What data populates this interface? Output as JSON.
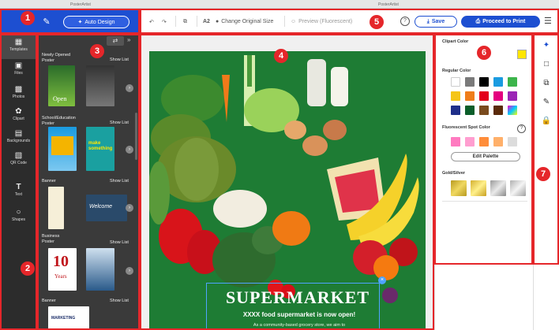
{
  "window": {
    "tab1_title": "PosterArtist",
    "tab2_title": "PosterArtist"
  },
  "header": {
    "auto_design_label": "Auto Design",
    "colors": {
      "brand": "#1d4fd1",
      "annotation": "#e5262a"
    }
  },
  "toolbar": {
    "size_label": "A2",
    "change_size_label": "Change Original Size",
    "preview_label": "Preview (Fluorescent)",
    "save_label": "Save",
    "print_label": "Proceed to Print",
    "help_label": "?"
  },
  "sidebar": {
    "items": [
      {
        "label": "Templates",
        "icon": "templates-icon"
      },
      {
        "label": "Files",
        "icon": "files-icon"
      },
      {
        "label": "Photos",
        "icon": "photos-icon"
      },
      {
        "label": "Clipart",
        "icon": "clipart-icon"
      },
      {
        "label": "Backgrounds",
        "icon": "backgrounds-icon"
      },
      {
        "label": "QR Code",
        "icon": "qrcode-icon"
      },
      {
        "label": "Text",
        "icon": "text-icon"
      },
      {
        "label": "Shapes",
        "icon": "shapes-icon"
      }
    ]
  },
  "templates": {
    "sections": [
      {
        "title": "Newly Opened\nPoster",
        "show_list": "Show List"
      },
      {
        "title": "School/Education\nPoster",
        "show_list": "Show List"
      },
      {
        "title": "Banner",
        "show_list": "Show List"
      },
      {
        "title": "Business\nPoster",
        "show_list": "Show List"
      },
      {
        "title": "Banner",
        "show_list": "Show List"
      }
    ],
    "thumb_texts": {
      "open": "Open",
      "make": "make something",
      "ten": "10",
      "years": "Years",
      "welcome": "Welcome",
      "marketing": "MARKETING"
    }
  },
  "poster": {
    "title": "SUPERMARKET",
    "subtitle": "XXXX food supermarket is now open!",
    "description": "As a community-based grocery store, we aim to"
  },
  "color_panel": {
    "clipart_color": "Clipart Color",
    "regular_color": "Regular Color",
    "fluorescent_spot": "Fluorescent Spot Color",
    "edit_palette": "Edit Palette",
    "gold_silver": "Gold/Silver",
    "help": "?",
    "regular_swatches": [
      "#ffffff",
      "#7a7a7a",
      "#000000",
      "#1a9be0",
      "#3cb44b",
      "#f5c518",
      "#ef7d1a",
      "#e3001b",
      "#e4007f",
      "#9b26b6",
      "#1f2f8a",
      "#0b5e2a",
      "#7a4b1e",
      "#5a2a0a",
      "#7fa0d8"
    ],
    "fluor_swatches": [
      "#ff7ac0",
      "#ff9ed0",
      "#ff8d3a",
      "#ffb06a",
      "#dcdcdc"
    ],
    "gold_silver_swatches": [
      "#d8b638",
      "#e6c54a",
      "#b8b8b8",
      "#cfcfcf"
    ]
  },
  "annotations": [
    "1",
    "2",
    "3",
    "4",
    "5",
    "6",
    "7"
  ]
}
